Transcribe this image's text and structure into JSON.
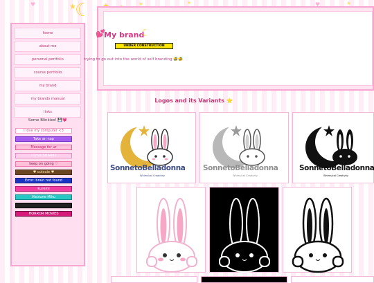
{
  "sidebar": {
    "nav": [
      {
        "label": "home"
      },
      {
        "label": "about me"
      },
      {
        "label": "personal portfolio"
      },
      {
        "label": "course portfolio"
      },
      {
        "label": "my brand"
      },
      {
        "label": "my brands manual"
      },
      {
        "label": "links"
      }
    ],
    "blinkies_title": "Some Blinkies! 💾💗",
    "blinkies": [
      {
        "text": "I love my computer <3",
        "bg": "#ffffff",
        "fg": "#e0468f",
        "border": "#f39ac5"
      },
      {
        "text": "Take an nap",
        "bg": "#a45cf0",
        "fg": "#ffffff",
        "border": "#7a35c8"
      },
      {
        "text": "Message for ur",
        "bg": "#ffc1dc",
        "fg": "#c4206a",
        "border": "#e6609d"
      },
      {
        "text": "I Love SHARIO",
        "bg": "#ffd0ec",
        "fg": "#ffffff",
        "border": "#e58cc2"
      },
      {
        "text": "keep on going ♡",
        "bg": "#ffbfd9",
        "fg": "#7a1b4a",
        "border": "#ee7aab"
      },
      {
        "text": "♥ cutcuie ♥",
        "bg": "#6c4522",
        "fg": "#ffe7b0",
        "border": "#4a2d12"
      },
      {
        "text": "Error: brain not found",
        "bg": "#1a35c4",
        "fg": "#ffffff",
        "border": "#0d1f80"
      },
      {
        "text": "kuromi",
        "bg": "#f33fa1",
        "fg": "#ffffff",
        "border": "#b51c72"
      },
      {
        "text": "Hatsune Miku",
        "bg": "#28c7c4",
        "fg": "#ffffff",
        "border": "#0b8d8a"
      },
      {
        "text": "",
        "bg": "#222222",
        "fg": "#ffffff",
        "border": "#000000"
      },
      {
        "text": "HORROR MOVIES",
        "bg": "#d61a7a",
        "fg": "#ffffff",
        "border": "#7a0b45"
      }
    ]
  },
  "header": {
    "title": "My brand",
    "under_construction": "UNDER CONSTRUCTION",
    "tagline": "trying to go out into the world of self branding 🤣🤣"
  },
  "section_title": "Logos and its Variants ⭐",
  "logo_variants": [
    {
      "wordmark": "SonnetoBelladonna",
      "subtitle": "Whimsical Creativity",
      "moon": "#e3b33a",
      "star": "#e3b33a",
      "wordmark_color": "#3c4b82",
      "subtitle_color": "#3c4b82"
    },
    {
      "wordmark": "SonnetoBelladonna",
      "subtitle": "Whimsical Creativity",
      "moon": "#b8b8b8",
      "star": "#9a9a9a",
      "wordmark_color": "#909090",
      "subtitle_color": "#909090"
    },
    {
      "wordmark": "SonnetoBelladonna",
      "subtitle": "Whimsical Creativity",
      "moon": "#111111",
      "star": "#111111",
      "wordmark_color": "#111111",
      "subtitle_color": "#111111"
    }
  ],
  "icon_variants": [
    {
      "style": "color"
    },
    {
      "style": "inverted"
    },
    {
      "style": "outline"
    }
  ]
}
